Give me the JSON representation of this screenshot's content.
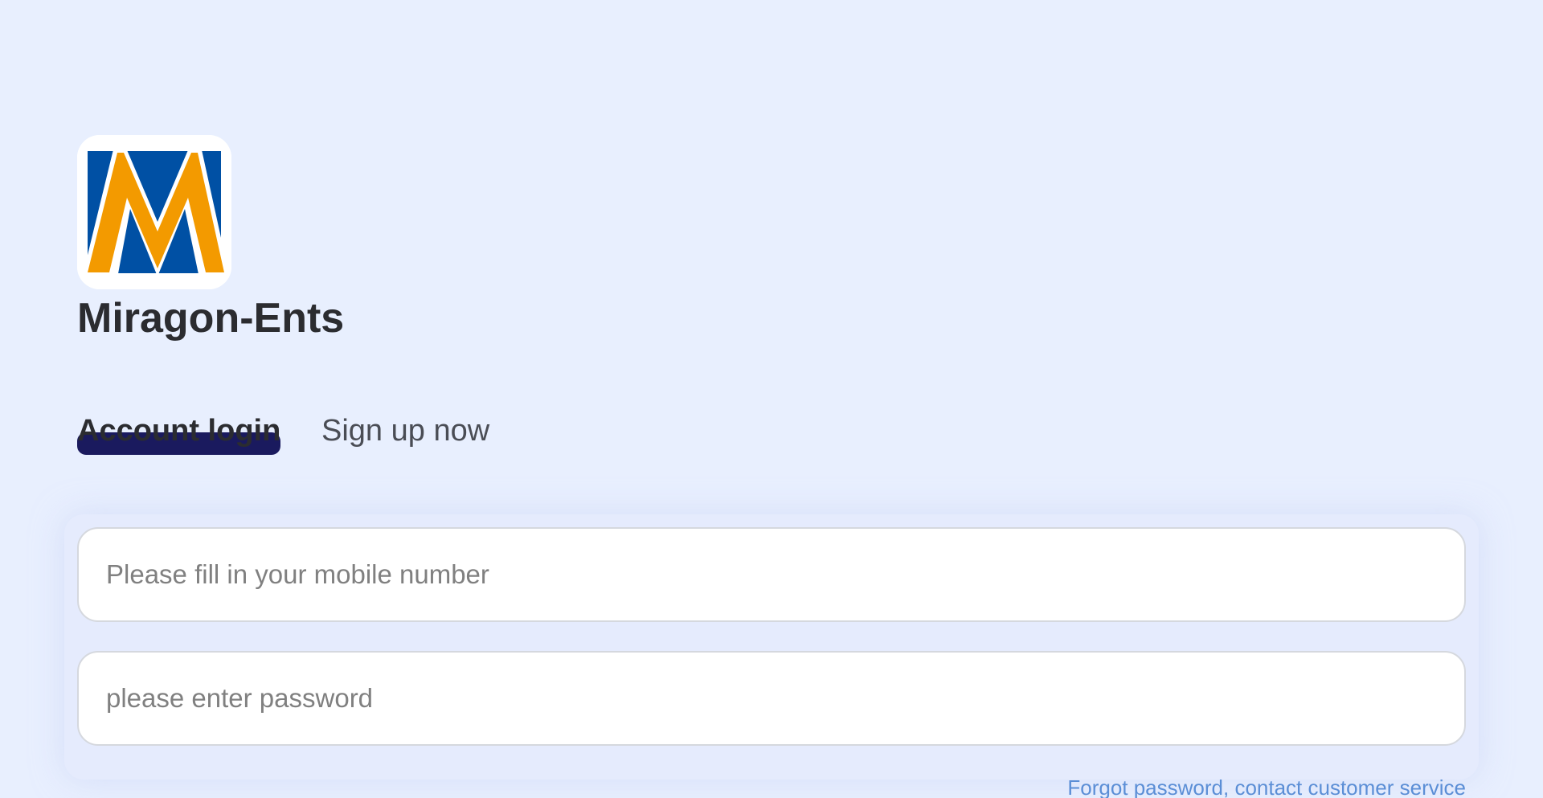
{
  "brand": {
    "name": "Miragon-Ents",
    "logo_icon": "miragon-m-logo-icon",
    "colors": {
      "logo_blue": "#0050a4",
      "logo_orange": "#f39a00"
    }
  },
  "tabs": {
    "items": [
      {
        "label": "Account login",
        "active": true
      },
      {
        "label": "Sign up now",
        "active": false
      }
    ],
    "active_color": "#1a1a5e"
  },
  "form": {
    "phone_placeholder": "Please fill in your mobile number",
    "phone_value": "",
    "password_placeholder": "please enter password",
    "password_value": "",
    "forgot_label": "Forgot password, contact customer service"
  },
  "colors": {
    "background": "#e8effe",
    "link": "#5b8ed6",
    "text_dark": "#2b2c30"
  }
}
